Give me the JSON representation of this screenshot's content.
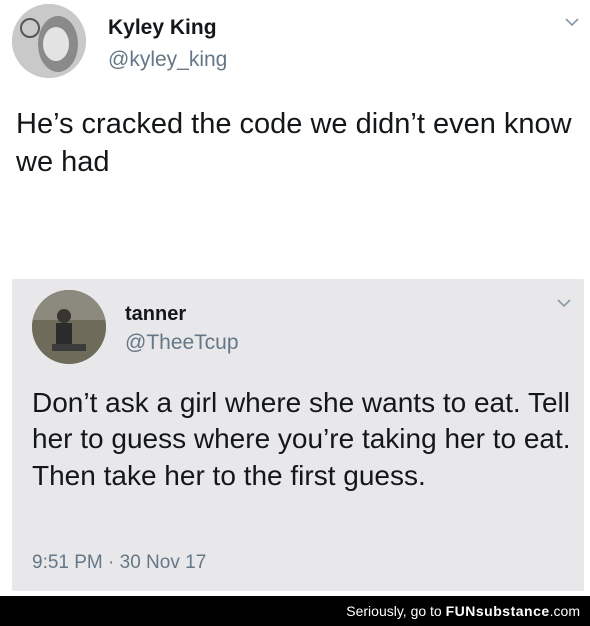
{
  "outer_tweet": {
    "display_name": "Kyley King",
    "handle": "@kyley_king",
    "text": "He’s cracked the code we didn’t even know we had"
  },
  "quoted_tweet": {
    "display_name": "tanner",
    "handle": "@TheeTcup",
    "text": "Don’t ask a girl where she wants to eat. Tell her to guess where you’re taking her to eat. Then take her to the first guess.",
    "timestamp": "9:51 PM · 30 Nov 17"
  },
  "watermark": {
    "prefix": "Seriously, go to ",
    "brand": "FUNsubstance",
    "suffix": ".com"
  },
  "icons": [
    "chevron-down-icon",
    "avatar"
  ],
  "colors": {
    "handle": "#657786",
    "quote_bg": "#e8e8ea",
    "footer_bg": "#000000"
  }
}
